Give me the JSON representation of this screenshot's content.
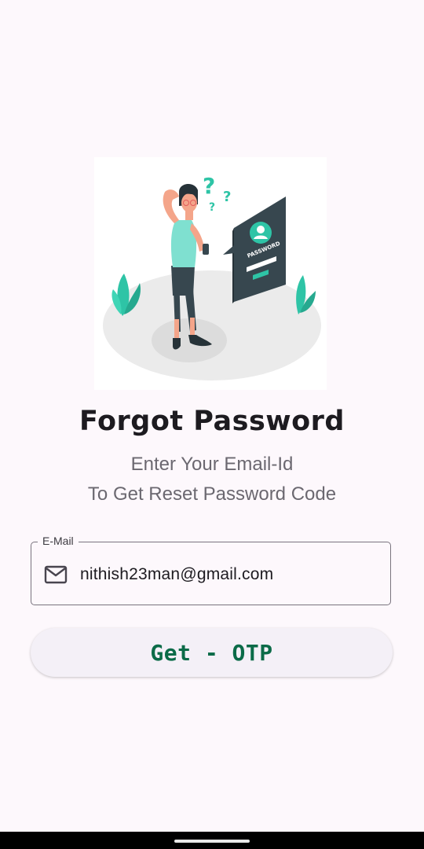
{
  "screen": {
    "title": "Forgot Password",
    "subtitle_line1": "Enter Your Email-Id",
    "subtitle_line2": "To Get Reset Password Code"
  },
  "illustration": {
    "label": "PASSWORD",
    "question_marks": "? ? ?"
  },
  "email_field": {
    "label": "E-Mail",
    "value": "nithish23man@gmail.com",
    "icon": "mail-icon"
  },
  "otp_button": {
    "label": "Get - OTP"
  },
  "colors": {
    "background": "#fdf8fc",
    "accent": "#2ec4a6",
    "button_text": "#0b6b48",
    "illustration_panel": "#37474f"
  }
}
